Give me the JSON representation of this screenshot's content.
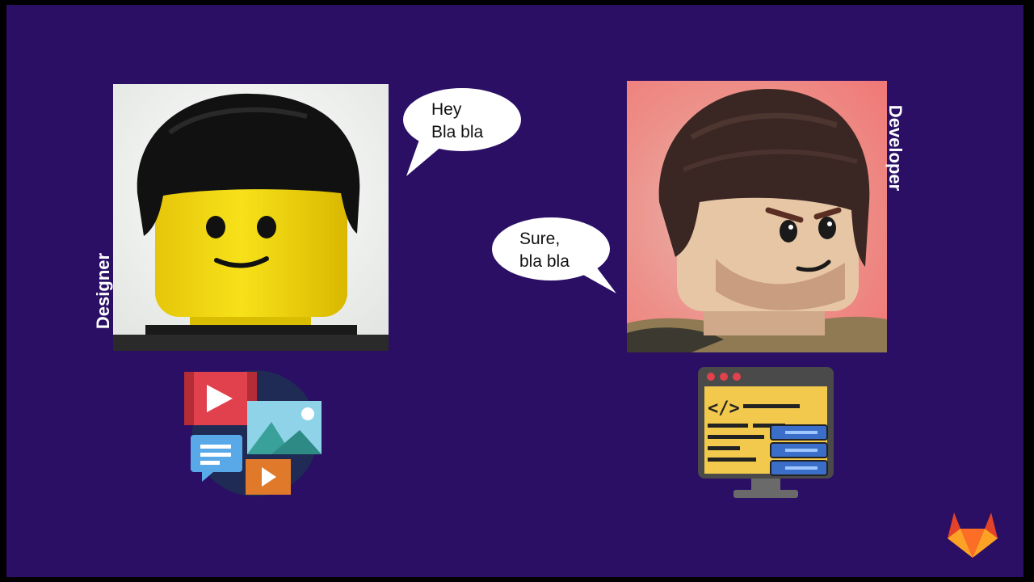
{
  "slide": {
    "background": "#2a0f65",
    "designer": {
      "label": "Designer",
      "speech": [
        "Hey",
        "Bla bla"
      ],
      "icon": "media-files-icon"
    },
    "developer": {
      "label": "Developer",
      "speech": [
        "Sure,",
        "bla bla"
      ],
      "icon": "code-server-monitor-icon"
    },
    "logo": "gitlab-tanuki-logo"
  }
}
